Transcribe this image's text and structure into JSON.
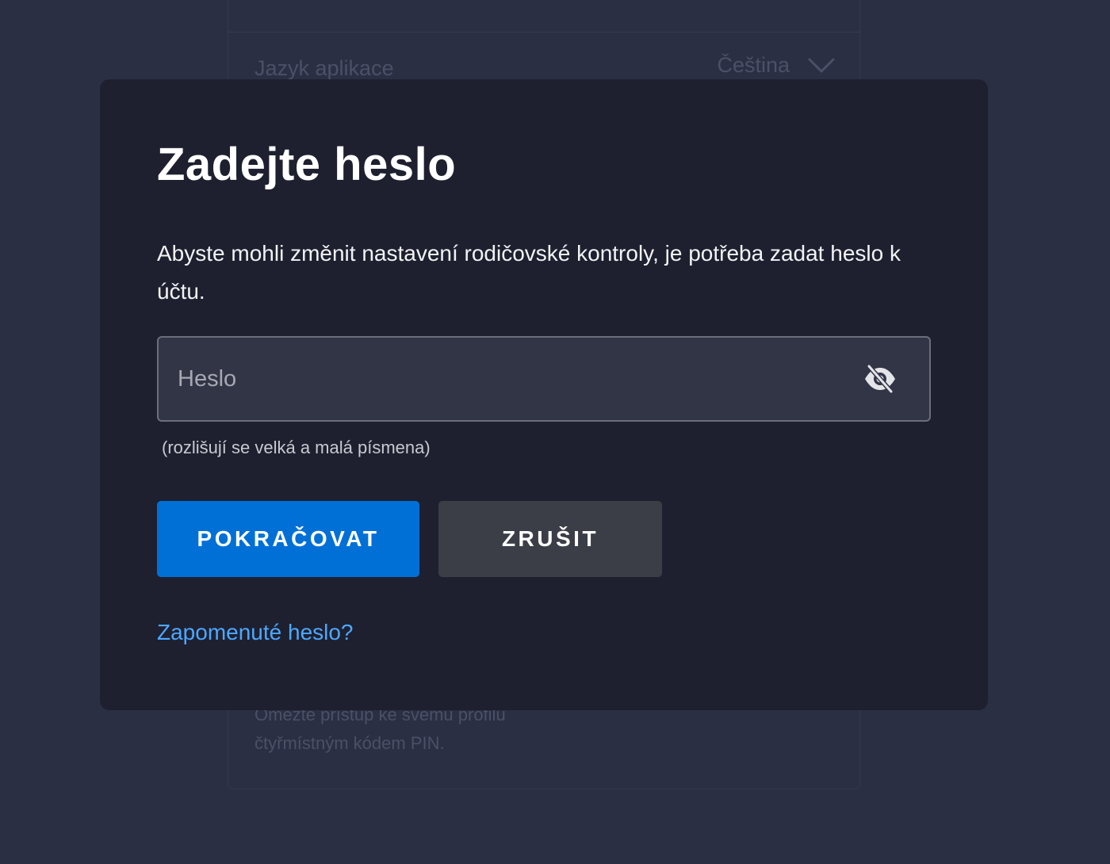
{
  "background": {
    "language_row": {
      "label": "Jazyk aplikace",
      "value": "Čeština",
      "chevron_icon": "chevron-down-icon"
    },
    "pin_description": "Omezte přístup ke svému profilu čtyřmístným kódem PIN."
  },
  "modal": {
    "title": "Zadejte heslo",
    "description": "Abyste mohli změnit nastavení rodičovské kontroly, je potřeba zadat heslo k účtu.",
    "password_field": {
      "placeholder": "Heslo",
      "value": "",
      "toggle_icon": "eye-slash-icon"
    },
    "hint": "(rozlišují se velká a malá písmena)",
    "continue_label": "POKRAČOVAT",
    "cancel_label": "ZRUŠIT",
    "forgot_link": "Zapomenuté heslo?"
  },
  "colors": {
    "page_background": "#2b2f43",
    "modal_background": "#1e2030",
    "primary_button": "#0070d6",
    "secondary_button": "#3b3d47",
    "link": "#4da8ff"
  }
}
